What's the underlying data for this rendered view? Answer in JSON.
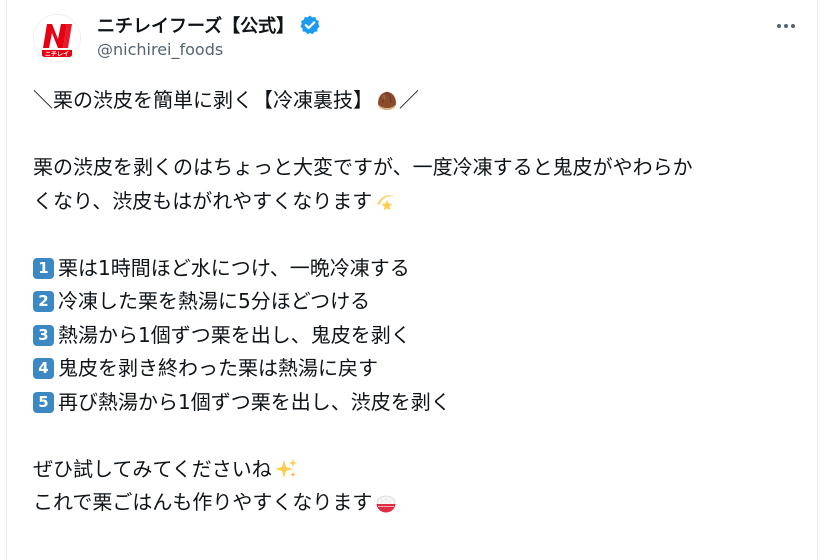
{
  "account": {
    "display_name": "ニチレイフーズ【公式】",
    "handle": "@nichirei_foods",
    "logo_text": "ニチレイ",
    "logo_letter": "N"
  },
  "tweet": {
    "title_line": "＼栗の渋皮を簡単に剥く【冷凍裏技】",
    "title_end": "／",
    "intro_line1": "栗の渋皮を剥くのはちょっと大変ですが、一度冷凍すると鬼皮がやわらか",
    "intro_line2": "くなり、渋皮もはがれやすくなります",
    "steps": [
      {
        "num": "1",
        "text": "栗は1時間ほど水につけ、一晩冷凍する"
      },
      {
        "num": "2",
        "text": "冷凍した栗を熱湯に5分ほどつける"
      },
      {
        "num": "3",
        "text": "熱湯から1個ずつ栗を出し、鬼皮を剥く"
      },
      {
        "num": "4",
        "text": "鬼皮を剥き終わった栗は熱湯に戻す"
      },
      {
        "num": "5",
        "text": "再び熱湯から1個ずつ栗を出し、渋皮を剥く"
      }
    ],
    "closing_line1": "ぜひ試してみてくださいね",
    "closing_line2": "これで栗ごはんも作りやすくなります"
  },
  "icons": {
    "verified": "verified-badge-icon",
    "more": "more-options-icon",
    "chestnut": "chestnut-emoji",
    "dizzy": "dizzy-star-emoji",
    "sparkles": "sparkles-emoji",
    "rice": "rice-bowl-emoji"
  },
  "colors": {
    "verified": "#1d9bf0",
    "brand_red": "#e60012",
    "keycap": "#3b88c3",
    "handle": "#536471"
  }
}
